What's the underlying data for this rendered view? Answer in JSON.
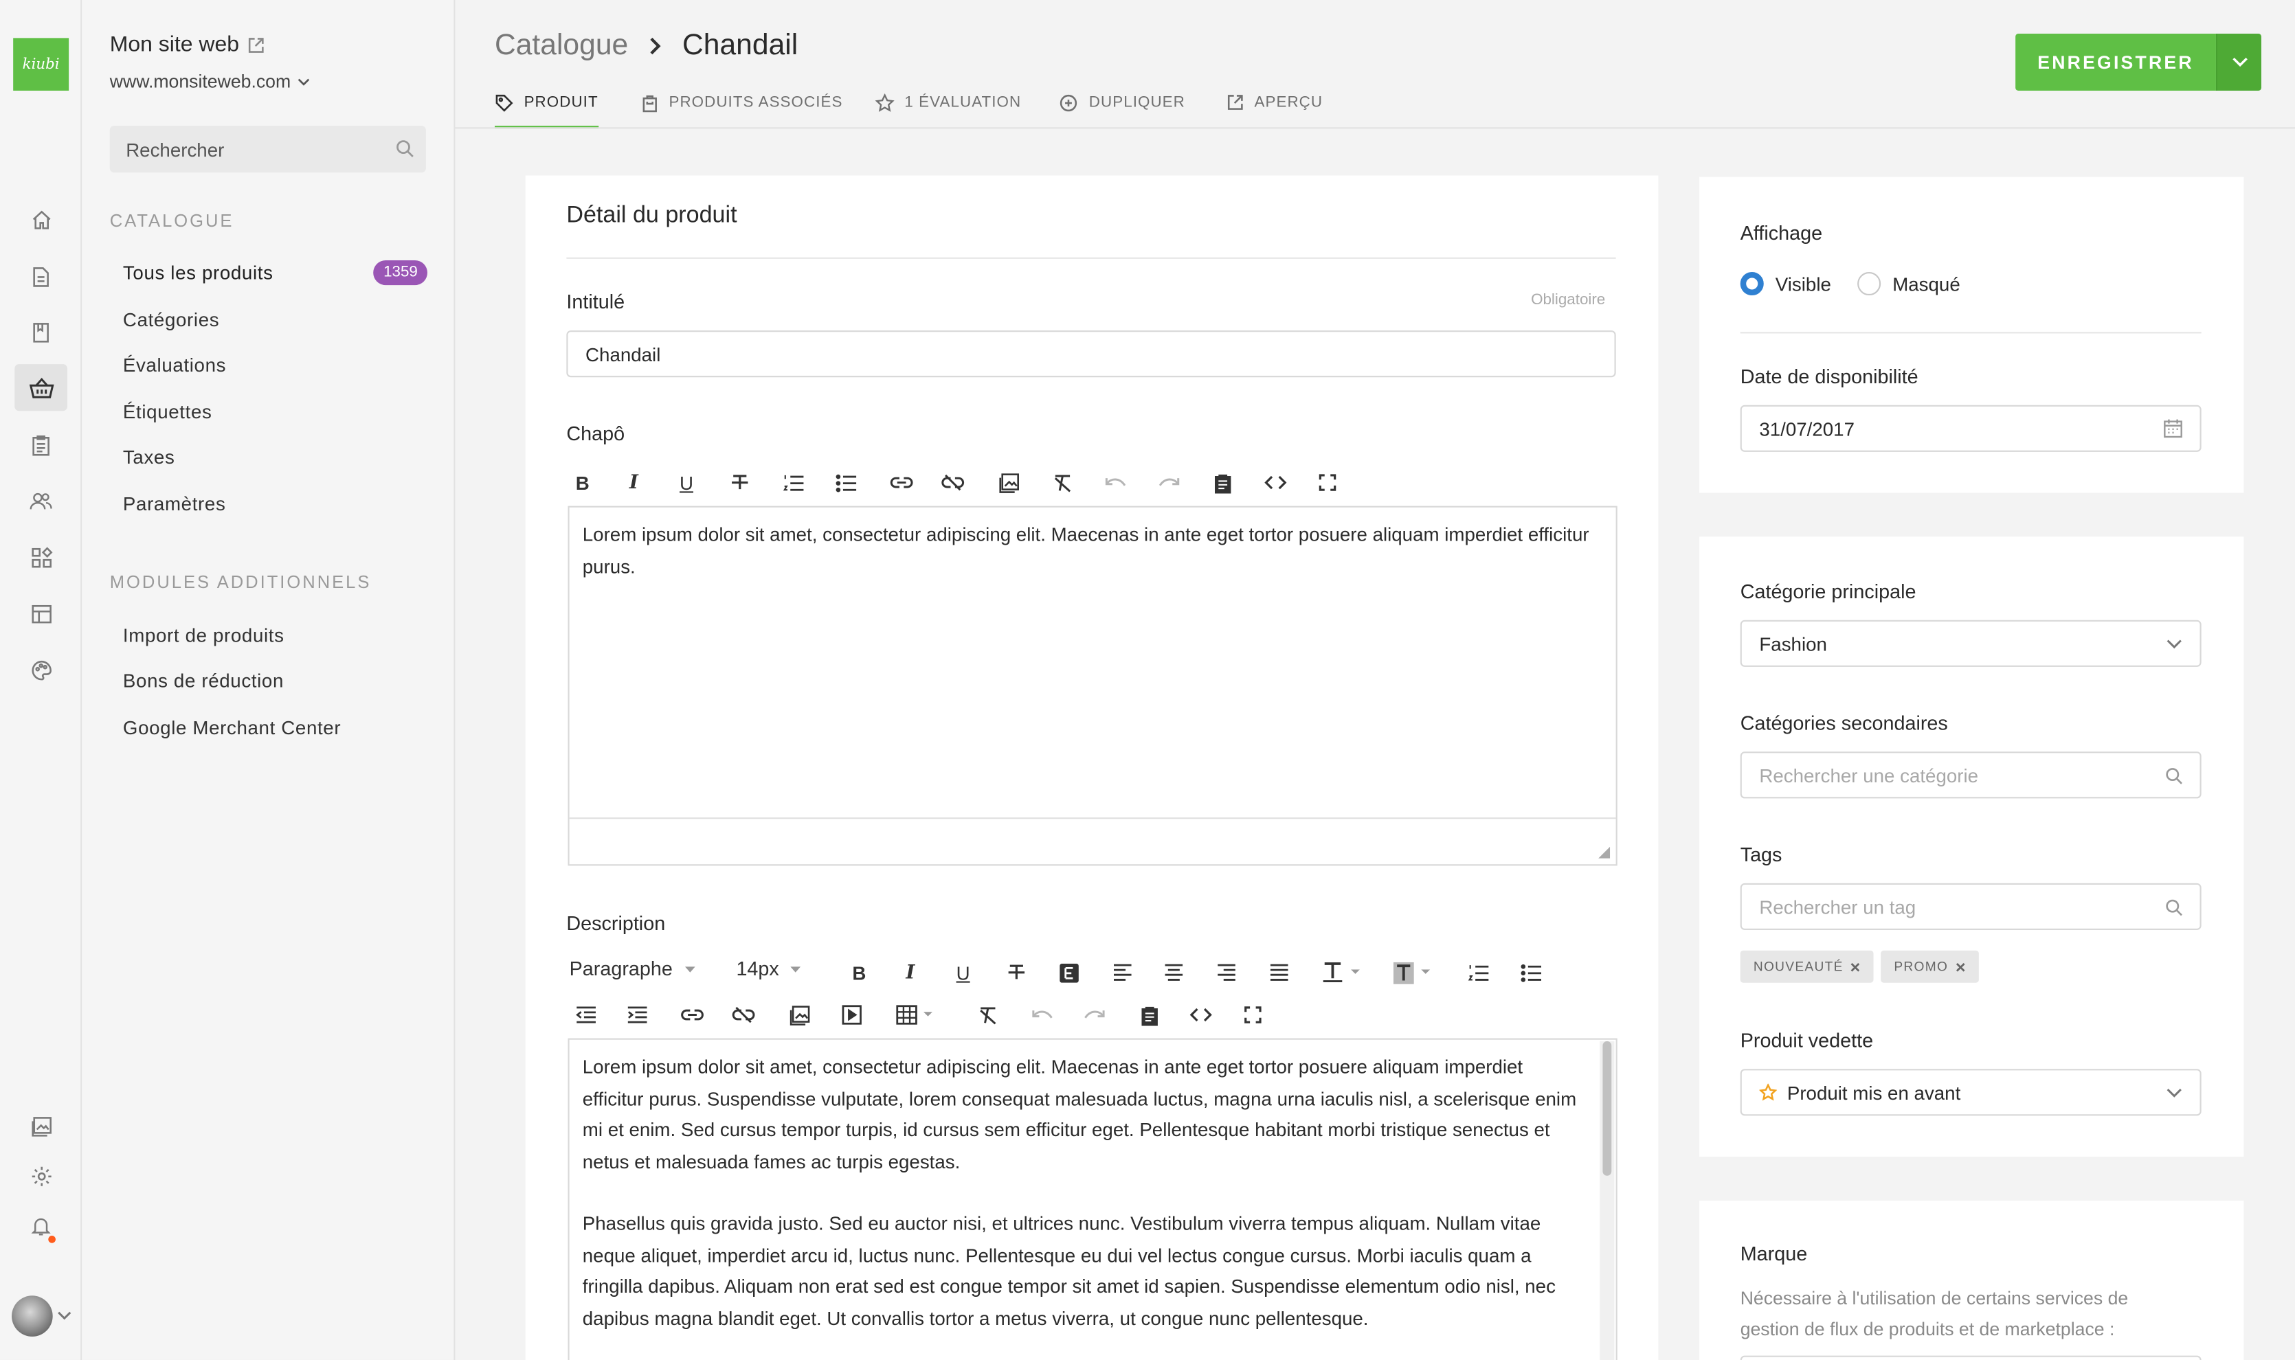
{
  "app": {
    "logo_text": "kiubi",
    "brand_color": "#5fbf45"
  },
  "site": {
    "name": "Mon site web",
    "url": "www.monsiteweb.com"
  },
  "sidebar": {
    "search_placeholder": "Rechercher",
    "catalogue_title": "Catalogue",
    "catalogue_items": [
      {
        "label": "Tous les produits",
        "badge": "1359"
      },
      {
        "label": "Catégories"
      },
      {
        "label": "Évaluations"
      },
      {
        "label": "Étiquettes"
      },
      {
        "label": "Taxes"
      },
      {
        "label": "Paramètres"
      }
    ],
    "modules_title": "Modules additionnels",
    "modules_items": [
      "Import de produits",
      "Bons de réduction",
      "Google Merchant Center"
    ]
  },
  "rail_icons": [
    "home-icon",
    "page-icon",
    "book-icon",
    "basket-icon",
    "clipboard-icon",
    "users-icon",
    "modules-icon",
    "layout-icon",
    "palette-icon",
    "media-icon",
    "gear-icon",
    "bell-icon"
  ],
  "header": {
    "breadcrumb_parent": "Catalogue",
    "breadcrumb_current": "Chandail",
    "tabs": [
      "Produit",
      "Produits associés",
      "1 évaluation",
      "Dupliquer",
      "Aperçu"
    ],
    "save_label": "ENREGISTRER"
  },
  "detail": {
    "title": "Détail du produit",
    "intitule_label": "Intitulé",
    "required_hint": "Obligatoire",
    "intitule_value": "Chandail",
    "chapo_label": "Chapô",
    "chapo_text": "Lorem ipsum dolor sit amet, consectetur adipiscing elit. Maecenas in ante eget tortor posuere aliquam imperdiet efficitur purus.",
    "description_label": "Description",
    "format_select": "Paragraphe",
    "size_select": "14px",
    "desc_p1": "Lorem ipsum dolor sit amet, consectetur adipiscing elit. Maecenas in ante eget tortor posuere aliquam imperdiet efficitur purus. Suspendisse vulputate, lorem consequat malesuada luctus, magna urna iaculis nisl, a scelerisque enim mi et enim. Sed cursus tempor turpis, id cursus sem efficitur eget. Pellentesque habitant morbi tristique senectus et netus et malesuada fames ac turpis egestas.",
    "desc_p2": "Phasellus quis gravida justo. Sed eu auctor nisi, et ultrices nunc. Vestibulum viverra tempus aliquam. Nullam vitae neque aliquet, imperdiet arcu id, luctus nunc. Pellentesque eu dui vel lectus congue cursus. Morbi iaculis quam a fringilla dapibus. Aliquam non erat sed est congue tempor sit amet id sapien. Suspendisse elementum odio nisl, nec dapibus magna blandit eget. Ut convallis tortor a metus viverra, ut congue nunc pellentesque."
  },
  "display": {
    "affichage_label": "Affichage",
    "visible_label": "Visible",
    "masque_label": "Masqué",
    "selected": "Visible",
    "date_label": "Date de disponibilité",
    "date_value": "31/07/2017"
  },
  "categories": {
    "main_label": "Catégorie principale",
    "main_value": "Fashion",
    "secondary_label": "Catégories secondaires",
    "secondary_placeholder": "Rechercher une catégorie",
    "tags_label": "Tags",
    "tags_placeholder": "Rechercher un tag",
    "tags": [
      "Nouveauté",
      "Promo"
    ],
    "featured_label": "Produit vedette",
    "featured_value": "Produit mis en avant"
  },
  "brand": {
    "label": "Marque",
    "help": "Nécessaire à l'utilisation de certains services de gestion de flux de produits et de marketplace :"
  },
  "colors": {
    "accent": "#5fbf45",
    "badge": "#9a56b5",
    "radio": "#2f80d1",
    "star": "#f2a321",
    "notif": "#ff5c1c"
  }
}
